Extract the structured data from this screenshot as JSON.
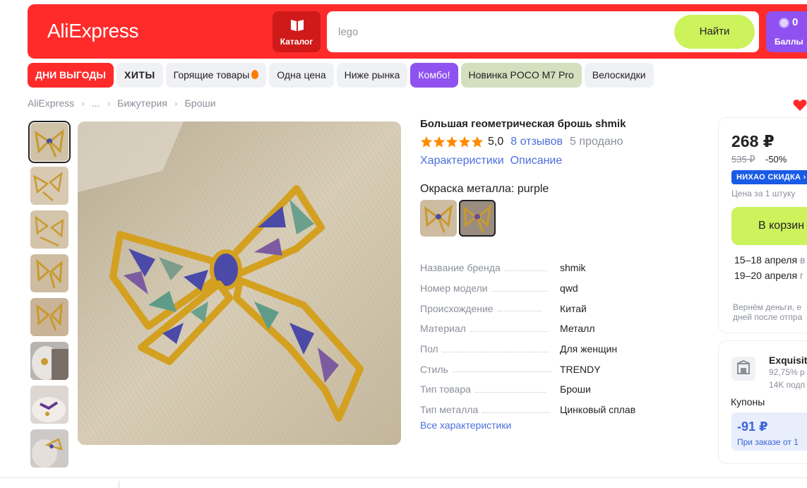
{
  "header": {
    "logo": "AliExpress",
    "catalog_label": "Каталог",
    "search_value": "lego",
    "search_button": "Найти",
    "bonus_count": "0",
    "bonus_label": "Баллы"
  },
  "promo_chips": [
    {
      "label": "ДНИ ВЫГОДЫ"
    },
    {
      "label": "ХИТЫ"
    },
    {
      "label": "Горящие товары"
    },
    {
      "label": "Одна цена"
    },
    {
      "label": "Ниже рынка"
    },
    {
      "label": "Комбо!"
    },
    {
      "label": "Новинка POCO M7 Pro"
    },
    {
      "label": "Велоскидки"
    }
  ],
  "breadcrumb": [
    "AliExpress",
    "...",
    "Бижутерия",
    "Броши"
  ],
  "product": {
    "title": "Большая геометрическая брошь shmik",
    "rating": "5,0",
    "reviews": "8 отзывов",
    "sold": "5 продано",
    "tabs": [
      "Характеристики",
      "Описание"
    ],
    "variant_label": "Окраска металла: purple",
    "all_specs_link": "Все характеристики"
  },
  "specs": [
    {
      "key": "Название бренда",
      "value": "shmik"
    },
    {
      "key": "Номер модели",
      "value": "qwd"
    },
    {
      "key": "Происхождение",
      "value": "Китай"
    },
    {
      "key": "Материал",
      "value": "Металл"
    },
    {
      "key": "Пол",
      "value": "Для женщин"
    },
    {
      "key": "Стиль",
      "value": "TRENDY"
    },
    {
      "key": "Тип товара",
      "value": "Броши"
    },
    {
      "key": "Тип металла",
      "value": "Цинковый сплав"
    }
  ],
  "buy_box": {
    "price": "268 ₽",
    "old_price": "535 ₽",
    "discount": "-50%",
    "badge": "НИХАО СКИДКА ›",
    "per_unit": "Цена за 1 штуку",
    "cart_button": "В корзин",
    "delivery_1": "15–18 апреля",
    "delivery_1_suffix": "в",
    "delivery_2": "19–20 апреля",
    "delivery_2_suffix": "г",
    "refund_1": "Вернём деньги, е",
    "refund_2": "дней после отпра"
  },
  "store": {
    "name": "Exquisit",
    "rating": "92,75% р",
    "followers": "14K подп",
    "coupons_label": "Купоны",
    "coupon_amount": "-91 ₽",
    "coupon_condition": "При заказе от 1"
  },
  "colors": {
    "brand_red": "#ff2b2b",
    "accent_green": "#ccf25c",
    "accent_purple": "#8f52f0",
    "link_blue": "#4c6fde"
  }
}
